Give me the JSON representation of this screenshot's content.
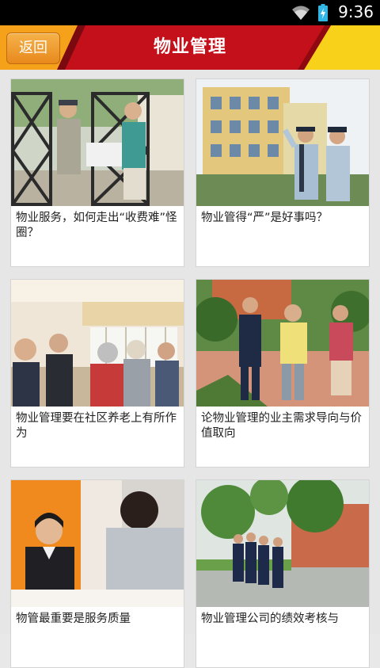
{
  "status_bar": {
    "time": "9:36"
  },
  "header": {
    "back_label": "返回",
    "title": "物业管理"
  },
  "articles": [
    {
      "title": "物业服务，如何走出“收费难”怪圈？"
    },
    {
      "title": "物业管得“严”是好事吗？"
    },
    {
      "title": "物业管理要在社区养老上有所作为"
    },
    {
      "title": "论物业管理的业主需求导向与价值取向"
    },
    {
      "title": "物管最重要是服务质量"
    },
    {
      "title": "物业管理公司的绩效考核与"
    }
  ]
}
